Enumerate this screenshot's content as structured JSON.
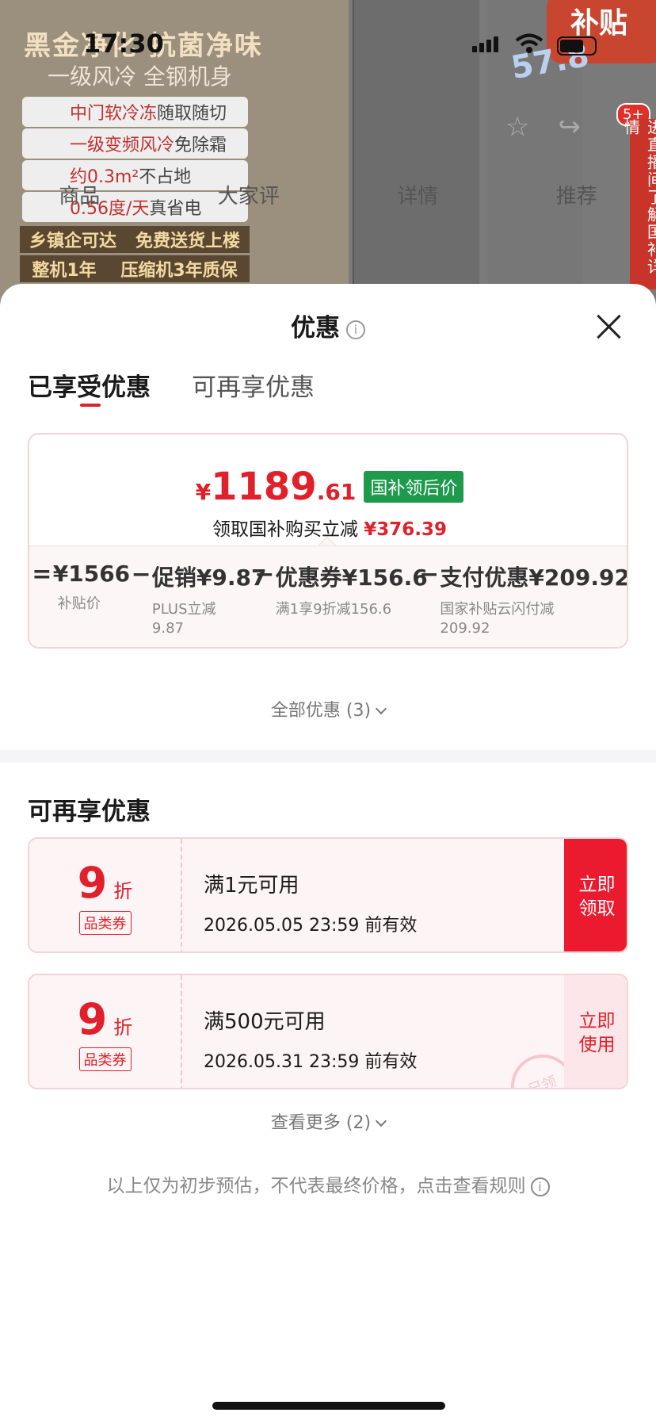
{
  "status": {
    "time": "17:30"
  },
  "background": {
    "promo_title": "黑金净化 抗菌净味",
    "promo_sub": "一级风冷 全钢机身",
    "features": [
      {
        "hl": "中门软冷冻",
        "rest": "随取随切"
      },
      {
        "hl": "一级变频风冷",
        "rest": "免除霜"
      },
      {
        "hl": "约0.3m²",
        "rest": "不占地"
      },
      {
        "hl": "0.56度/天",
        "rest": "真省电"
      }
    ],
    "ribbons": [
      [
        "乡镇企可达",
        "免费送货上楼"
      ],
      [
        "整机1年",
        "压缩机3年质保"
      ]
    ],
    "nav_tabs": [
      "商品",
      "大家评",
      "详情",
      "推荐"
    ],
    "corner_text": "补贴",
    "badge_value": "57.8",
    "side_text": "进直播间了解国补详情",
    "bubble": "5+"
  },
  "sheet": {
    "title": "优惠",
    "tabs": {
      "active": "已享受优惠",
      "inactive": "可再享优惠"
    },
    "summary": {
      "yen": "¥",
      "price_int": "1189",
      "price_dec": ".61",
      "price_badge": "国补领后价",
      "reduce_text": "领取国补购买立减",
      "reduce_amount": "¥376.39",
      "calc": [
        {
          "op": "=",
          "value": "¥1566",
          "desc": "补贴价"
        },
        {
          "op": "−",
          "value": "促销¥9.87",
          "desc": "PLUS立减\n9.87"
        },
        {
          "op": "−",
          "value": "优惠券¥156.6",
          "desc": "满1享9折减156.6"
        },
        {
          "op": "−",
          "value": "支付优惠¥209.92",
          "desc": "国家补贴云闪付减\n209.92"
        }
      ]
    },
    "all_discounts": "全部优惠 (3)",
    "section2_title": "可再享优惠",
    "coupons": [
      {
        "discount": "9",
        "unit": "折",
        "tag": "品类券",
        "condition": "满1元可用",
        "validity": "2026.05.05 23:59 前有效",
        "action": "立即\n领取",
        "style": "red"
      },
      {
        "discount": "9",
        "unit": "折",
        "tag": "品类券",
        "condition": "满500元可用",
        "validity": "2026.05.31 23:59 前有效",
        "action": "立即\n使用",
        "style": "pink",
        "stamp": "已领"
      }
    ],
    "see_more": "查看更多 (2)",
    "disclaimer": "以上仅为初步预估，不代表最终价格，点击查看规则"
  }
}
